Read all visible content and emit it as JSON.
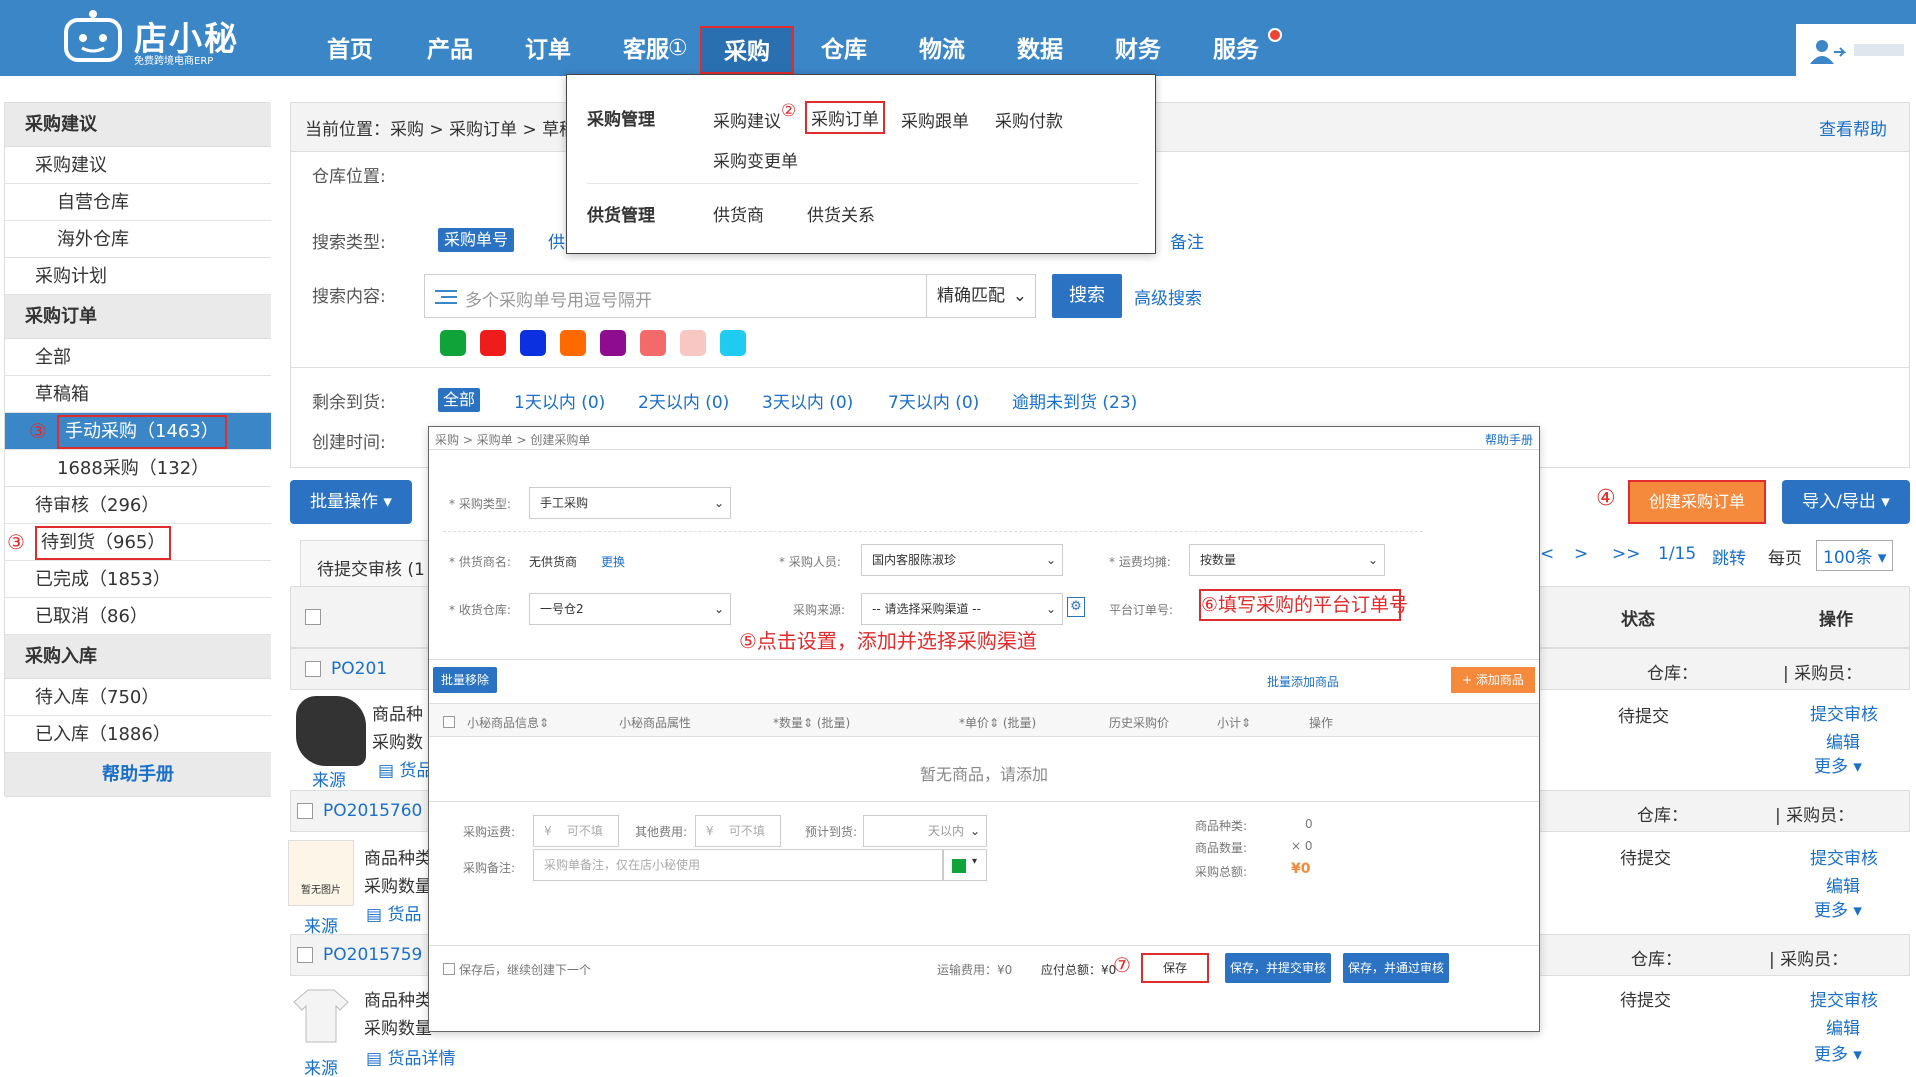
{
  "logo": {
    "title": "店小秘",
    "subtitle": "免费跨境电商ERP"
  },
  "nav": [
    "首页",
    "产品",
    "订单",
    "客服",
    "采购",
    "仓库",
    "物流",
    "数据",
    "财务",
    "服务"
  ],
  "annot": [
    "①",
    "②",
    "③",
    "③",
    "④",
    "⑤",
    "⑥",
    "⑦"
  ],
  "sidebar": {
    "g1": "采购建议",
    "g1_items": [
      "采购建议",
      "自营仓库",
      "海外仓库",
      "采购计划"
    ],
    "g2": "采购订单",
    "g2_items": [
      "全部",
      "草稿箱",
      "手动采购（1463）",
      "1688采购（132）",
      "待审核（296）",
      "待到货（965）",
      "已完成（1853）",
      "已取消（86）"
    ],
    "g3": "采购入库",
    "g3_items": [
      "待入库（750）",
      "已入库（1886）"
    ],
    "help": "帮助手册"
  },
  "breadcrumb": "当前位置：采购 > 采购订单 > 草稿箱",
  "help_link": "查看帮助",
  "filters": {
    "warehouse": "仓库位置:",
    "search_type": "搜索类型:",
    "type_active": "采购单号",
    "type_partial": "供",
    "type_note": "备注",
    "search_content": "搜索内容:",
    "placeholder": "多个采购单号用逗号隔开",
    "match": "精确匹配",
    "search_btn": "搜索",
    "adv": "高级搜索",
    "remain": "剩余到货:",
    "remain_opts": [
      "全部",
      "1天以内 (0)",
      "2天以内 (0)",
      "3天以内 (0)",
      "7天以内 (0)",
      "逾期未到货 (23)"
    ],
    "create_time": "创建时间:"
  },
  "swatches": [
    "#10a33a",
    "#ef1c1c",
    "#0b30e0",
    "#ff6a00",
    "#8e0c8e",
    "#f26a6a",
    "#f8c7c3",
    "#1fcbef"
  ],
  "dropdown": {
    "g1": "采购管理",
    "g1_items": [
      "采购建议",
      "采购订单",
      "采购跟单",
      "采购付款",
      "采购变更单"
    ],
    "g2": "供货管理",
    "g2_items": [
      "供货商",
      "供货关系"
    ]
  },
  "toolbar": {
    "batch": "批量操作 ▾",
    "create": "创建采购订单",
    "io": "导入/导出 ▾"
  },
  "pager": {
    "prev": "<",
    "next": ">",
    "last": ">>",
    "page": "1/15",
    "jump": "跳转",
    "per": "每页",
    "size": "100条 ▾"
  },
  "tab_label": "待提交审核 (1",
  "table": {
    "status": "状态",
    "op": "操作"
  },
  "orders": [
    {
      "no": "PO201",
      "wh": "仓库：",
      "buyer": "| 采购员：",
      "status": "待提交",
      "info": [
        "商品种",
        "采购数",
        "货品"
      ],
      "src": "来源"
    },
    {
      "no": "PO2015760",
      "wh": "仓库：",
      "buyer": "| 采购员：",
      "status": "待提交",
      "info": [
        "商品种类",
        "采购数量",
        "货品"
      ],
      "src": "来源",
      "img": "暂无图片"
    },
    {
      "no": "PO2015759",
      "wh": "仓库：",
      "buyer": "| 采购员：",
      "status": "待提交",
      "info": [
        "商品种类",
        "采购数量",
        "货品详情"
      ],
      "src": "来源"
    }
  ],
  "ops": [
    "提交审核",
    "编辑",
    "更多 ▾"
  ],
  "modal": {
    "crumb": "采购 > 采购单 > 创建采购单",
    "help": "帮助手册",
    "type_lbl": "* 采购类型:",
    "type_val": "手工采购",
    "supplier_lbl": "* 供货商名:",
    "supplier_val": "无供货商",
    "change": "更换",
    "buyer_lbl": "* 采购人员:",
    "buyer_val": "国内客服陈淑珍",
    "freight_lbl": "* 运费均摊:",
    "freight_val": "按数量",
    "wh_lbl": "* 收货仓库:",
    "wh_val": "一号仓2",
    "src_lbl": "采购来源:",
    "src_val": "-- 请选择采购渠道 --",
    "plat_lbl": "平台订单号:",
    "plat_val": "⑥填写采购的平台订单号",
    "tip5": "⑤点击设置，添加并选择采购渠道",
    "batch_remove": "批量移除",
    "batch_add": "批量添加商品",
    "add": "+ 添加商品",
    "cols": [
      "小秘商品信息⇕",
      "小秘商品属性",
      "*数量⇕ (批量)",
      "*单价⇕ (批量)",
      "历史采购价",
      "小计⇕",
      "操作"
    ],
    "empty": "暂无商品，请添加",
    "ship_lbl": "采购运费:",
    "other_lbl": "其他费用:",
    "eta_lbl": "预计到货:",
    "opt": "可不填",
    "yen": "¥",
    "days": "天以内",
    "note_lbl": "采购备注:",
    "note_ph": "采购单备注，仅在店小秘使用",
    "kinds_lbl": "商品种类:",
    "kinds": "0",
    "qty_lbl": "商品数量:",
    "qty": "× 0",
    "total_lbl": "采购总额:",
    "total": "¥0",
    "chk": "保存后，继续创建下一个",
    "ship_fee": "运输费用：¥0",
    "pay": "应付总额：¥0",
    "save": "保存",
    "save_submit": "保存，并提交审核",
    "save_pass": "保存，并通过审核"
  }
}
